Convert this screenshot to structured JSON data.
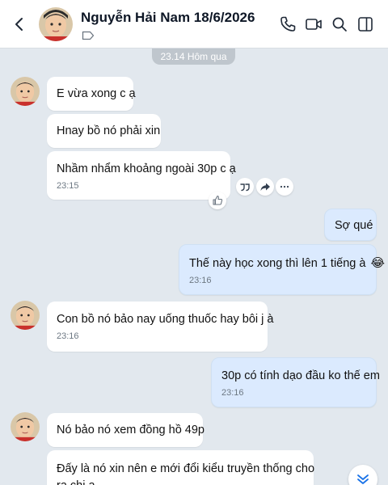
{
  "header": {
    "contact_name": "Nguyễn Hải Nam 18/6/2026"
  },
  "separator": {
    "time_label": "23.14 Hôm qua"
  },
  "messages": [
    {
      "text": "E vừa xong c ạ",
      "time": ""
    },
    {
      "text": "Hnay bồ nó phải xin",
      "time": ""
    },
    {
      "text": "Nhầm nhẩm khoảng ngoài 30p c ạ",
      "time": "23:15"
    },
    {
      "text": "Sợ qué",
      "time": ""
    },
    {
      "text": "Thế này học xong thì lên 1 tiếng à",
      "time": "23:16",
      "emoji": "😂"
    },
    {
      "text": "Con bồ nó bảo nay uống thuốc hay bôi j à",
      "time": "23:16"
    },
    {
      "text": "30p có tính dạo đầu ko thế em",
      "time": "23:16"
    },
    {
      "text": "Nó bảo nó xem đồng hồ 49p",
      "time": ""
    },
    {
      "text": "Đấy là nó xin nên e mới đổi kiểu truyền thống cho",
      "text2": "ra chị ạ",
      "time": ""
    }
  ],
  "icons": {
    "back": "back-arrow-icon",
    "tag": "tag-icon",
    "call": "phone-icon",
    "video": "video-icon",
    "search": "search-icon",
    "panel": "sidebar-panel-icon",
    "quote": "quote-icon",
    "forward": "forward-icon",
    "more": "more-icon",
    "like": "thumbs-up-icon",
    "scroll": "scroll-down-icon"
  },
  "colors": {
    "background": "#e2e8ee",
    "incoming_bubble": "#ffffff",
    "outgoing_bubble": "#dbeafe",
    "accent": "#1a73e8"
  }
}
